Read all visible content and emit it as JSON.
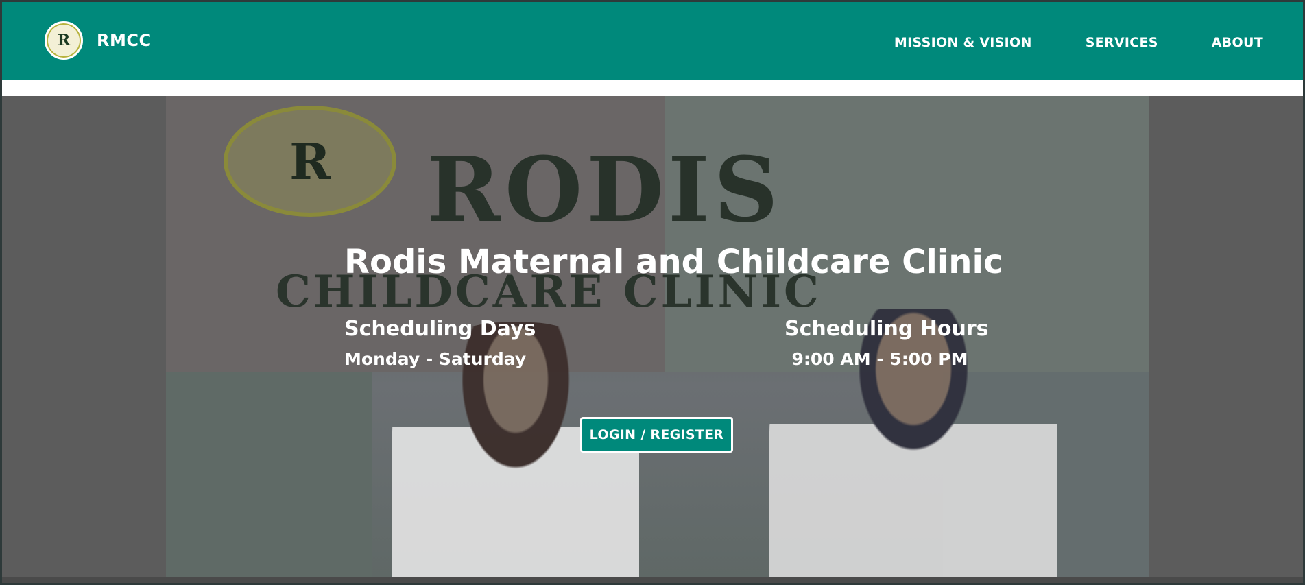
{
  "navbar": {
    "brand": "RMCC",
    "logo_icon": "rmcc-logo-icon",
    "logo_text": "R",
    "links": [
      {
        "label": "MISSION & VISION"
      },
      {
        "label": "SERVICES"
      },
      {
        "label": "ABOUT"
      }
    ]
  },
  "hero": {
    "title": "Rodis Maternal and Childcare Clinic",
    "background_banner": {
      "line1": "RODIS",
      "line2": "CHILDCARE CLINIC",
      "seal_text": "R"
    },
    "scheduling_days": {
      "label": "Scheduling Days",
      "value": "Monday - Saturday"
    },
    "scheduling_hours": {
      "label": "Scheduling Hours",
      "value": "9:00 AM - 5:00 PM"
    },
    "cta": "LOGIN / REGISTER"
  },
  "colors": {
    "primary": "#00897b",
    "overlay": "#5c5c5c",
    "text_light": "#ffffff"
  }
}
